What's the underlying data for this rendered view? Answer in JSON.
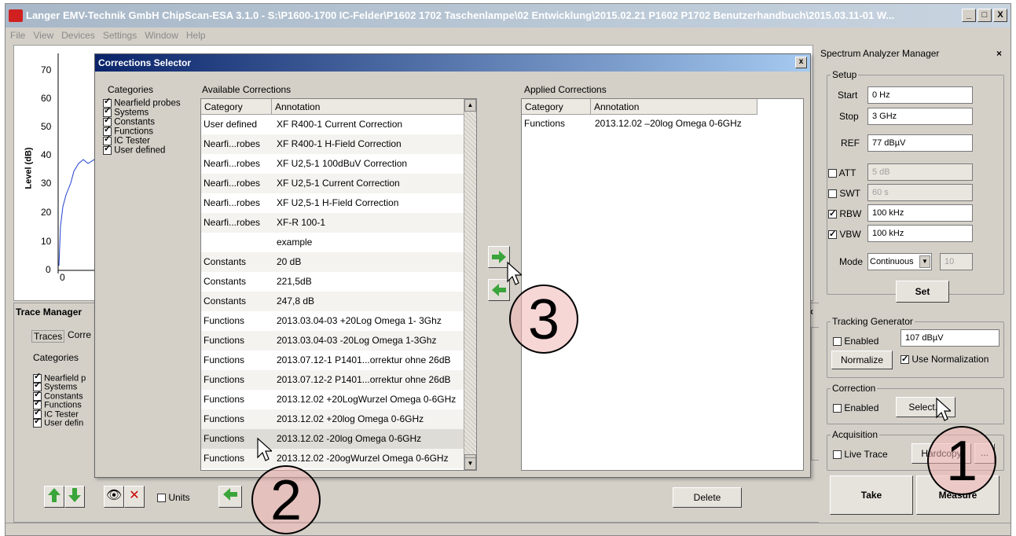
{
  "window": {
    "title": "Langer EMV-Technik GmbH ChipScan-ESA 3.1.0  -  S:\\P1600-1700 IC-Felder\\P1602 1702 Taschenlampe\\02 Entwicklung\\2015.02.21 P1602 P1702 Benutzerhandbuch\\2015.03.11-01 W...",
    "min": "_",
    "max": "□",
    "close": "X"
  },
  "menu": [
    "File",
    "View",
    "Devices",
    "Settings",
    "Window",
    "Help"
  ],
  "chart": {
    "ylabel": "Level (dB)",
    "yticks": [
      "70",
      "60",
      "50",
      "40",
      "30",
      "20",
      "10",
      "0"
    ],
    "xtick0": "0"
  },
  "dialog": {
    "title": "Corrections Selector",
    "close": "x",
    "categories_label": "Categories",
    "categories": [
      {
        "label": "Nearfield probes",
        "checked": true
      },
      {
        "label": "Systems",
        "checked": true
      },
      {
        "label": "Constants",
        "checked": true
      },
      {
        "label": "Functions",
        "checked": true
      },
      {
        "label": "IC Tester",
        "checked": true
      },
      {
        "label": "User defined",
        "checked": true
      }
    ],
    "available_label": "Available Corrections",
    "applied_label": "Applied Corrections",
    "col_category": "Category",
    "col_annotation": "Annotation",
    "available": [
      [
        "User defined",
        "XF R400-1 Current Correction"
      ],
      [
        "Nearfi...robes",
        "XF R400-1 H-Field Correction"
      ],
      [
        "Nearfi...robes",
        "XF U2,5-1 100dBuV Correction"
      ],
      [
        "Nearfi...robes",
        "XF U2,5-1 Current Correction"
      ],
      [
        "Nearfi...robes",
        "XF U2,5-1 H-Field Correction"
      ],
      [
        "Nearfi...robes",
        "XF-R 100-1"
      ],
      [
        "",
        "example"
      ],
      [
        "Constants",
        "20 dB"
      ],
      [
        "Constants",
        "221,5dB"
      ],
      [
        "Constants",
        "247,8 dB"
      ],
      [
        "Functions",
        "2013.03.04-03 +20Log Omega 1- 3Ghz"
      ],
      [
        "Functions",
        "2013.03.04-03 -20Log Omega 1-3Ghz"
      ],
      [
        "Functions",
        "2013.07.12-1 P1401...orrektur ohne 26dB"
      ],
      [
        "Functions",
        "2013.07.12-2 P1401...orrektur ohne 26dB"
      ],
      [
        "Functions",
        "2013.12.02 +20LogWurzel Omega 0-6GHz"
      ],
      [
        "Functions",
        "2013.12.02 +20log Omega 0-6GHz"
      ],
      [
        "Functions",
        "2013.12.02 -20log Omega 0-6GHz"
      ],
      [
        "Functions",
        "2013.12.02 -20ogWurzel Omega 0-6GHz"
      ]
    ],
    "applied": [
      [
        "Functions",
        "2013.12.02 –20log Omega 0-6GHz"
      ]
    ]
  },
  "trace_manager": {
    "title": "Trace Manager",
    "tabs": [
      "Traces",
      "Corre"
    ],
    "categories_label": "Categories",
    "categories": [
      "Nearfield p",
      "Systems",
      "Constants",
      "Functions",
      "IC Tester",
      "User defin"
    ],
    "units_label": "Units",
    "delete_label": "Delete"
  },
  "sam": {
    "title": "Spectrum Analyzer Manager",
    "close": "×",
    "setup_label": "Setup",
    "start_label": "Start",
    "start_value": "0 Hz",
    "stop_label": "Stop",
    "stop_value": "3 GHz",
    "ref_label": "REF",
    "ref_value": "77 dBµV",
    "att_label": "ATT",
    "att_value": "5 dB",
    "swt_label": "SWT",
    "swt_value": "60 s",
    "rbw_label": "RBW",
    "rbw_value": "100 kHz",
    "vbw_label": "VBW",
    "vbw_value": "100 kHz",
    "mode_label": "Mode",
    "mode_value": "Continuous",
    "mode_num": "10",
    "set_label": "Set",
    "tg_label": "Tracking Generator",
    "tg_enabled": "Enabled",
    "tg_value": "107 dBµV",
    "normalize_label": "Normalize",
    "use_norm_label": "Use Normalization",
    "correction_label": "Correction",
    "corr_enabled": "Enabled",
    "select_label": "Select...",
    "acq_label": "Acquisition",
    "live_trace": "Live Trace",
    "hardcopy_label": "Hardcopy",
    "more_label": "...",
    "take_label": "Take",
    "measure_label": "Measure"
  },
  "callouts": [
    "1",
    "2",
    "3"
  ],
  "colors": {
    "arrow_green": "#3aa53a",
    "chart_line": "#2040d0"
  }
}
